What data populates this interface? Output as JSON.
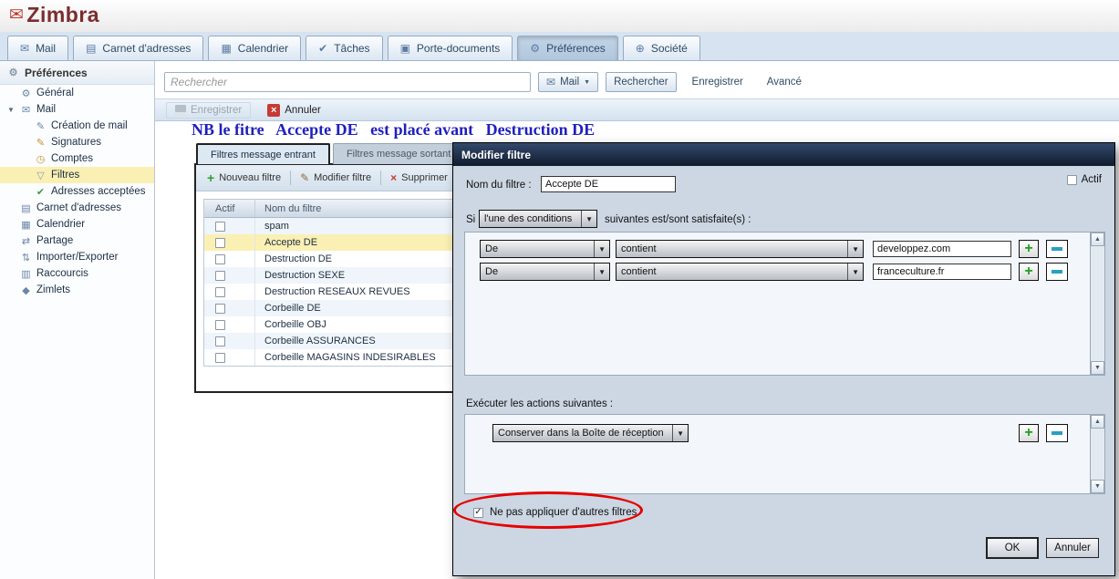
{
  "branding": {
    "logo_text": "Zimbra"
  },
  "colors": {
    "annotation_blue": "#1f1fbe",
    "annotation_red": "#e60000",
    "highlight_yellow": "#fbf0b4",
    "logo_red": "#7d2c2e",
    "modal_header": "#1b2a42"
  },
  "icons": {
    "logo_mark": "✉",
    "mail": "✉",
    "contacts": "▤",
    "calendar": "▦",
    "tasks": "✔",
    "briefcase": "▣",
    "gear": "⚙",
    "globe": "⊕",
    "compose": "✎",
    "signature": "✎",
    "accounts": "◷",
    "filter": "▽",
    "check_green": "✔",
    "share": "⇄",
    "import_export": "⇅",
    "shortcut": "▥",
    "zimlet": "◆",
    "expander_down": "▼",
    "dropdown_arrow": "▼",
    "scroll_up": "▲",
    "scroll_down": "▼",
    "plus": "+",
    "pencil": "✎",
    "close_x": "×",
    "checkmark": "✓"
  },
  "app_tabs": [
    {
      "label": "Mail"
    },
    {
      "label": "Carnet d'adresses"
    },
    {
      "label": "Calendrier"
    },
    {
      "label": "Tâches"
    },
    {
      "label": "Porte-documents"
    },
    {
      "label": "Préférences"
    },
    {
      "label": "Société"
    }
  ],
  "search_bar": {
    "placeholder": "Rechercher",
    "scope": "Mail",
    "search_button": "Rechercher",
    "save_button": "Enregistrer",
    "advanced_button": "Avancé"
  },
  "action_toolbar": {
    "save": "Enregistrer",
    "cancel": "Annuler"
  },
  "annotation_note": "NB le fitre   Accepte DE   est placé avant   Destruction DE",
  "sidebar": {
    "title": "Préférences",
    "items": [
      {
        "label": "Général"
      },
      {
        "label": "Mail"
      },
      {
        "label": "Création de mail"
      },
      {
        "label": "Signatures"
      },
      {
        "label": "Comptes"
      },
      {
        "label": "Filtres"
      },
      {
        "label": "Adresses acceptées"
      },
      {
        "label": "Carnet d'adresses"
      },
      {
        "label": "Calendrier"
      },
      {
        "label": "Partage"
      },
      {
        "label": "Importer/Exporter"
      },
      {
        "label": "Raccourcis"
      },
      {
        "label": "Zimlets"
      }
    ]
  },
  "filters_panel": {
    "tab_incoming": "Filtres message entrant",
    "tab_outgoing": "Filtres message sortant",
    "toolbar": {
      "new": "Nouveau filtre",
      "edit": "Modifier filtre",
      "delete": "Supprimer"
    },
    "columns": {
      "active": "Actif",
      "name": "Nom du filtre"
    },
    "rows": [
      {
        "name": "spam"
      },
      {
        "name": "Accepte DE"
      },
      {
        "name": "Destruction DE"
      },
      {
        "name": "Destruction SEXE"
      },
      {
        "name": "Destruction RESEAUX REVUES"
      },
      {
        "name": "Corbeille DE"
      },
      {
        "name": "Corbeille OBJ"
      },
      {
        "name": "Corbeille ASSURANCES"
      },
      {
        "name": "Corbeille MAGASINS INDESIRABLES"
      }
    ]
  },
  "dialog": {
    "title": "Modifier filtre",
    "name_label": "Nom du filtre :",
    "name_value": "Accepte DE",
    "active_label": "Actif",
    "if_prefix": "Si",
    "conditions_mode": "l'une des conditions",
    "if_suffix": "suivantes est/sont satisfaite(s) :",
    "conditions": [
      {
        "field": "De",
        "operator": "contient",
        "value": "developpez.com"
      },
      {
        "field": "De",
        "operator": "contient",
        "value": "franceculture.fr"
      }
    ],
    "actions_label": "Exécuter les actions suivantes :",
    "actions": [
      {
        "action": "Conserver dans la Boîte de réception"
      }
    ],
    "stop_label": "Ne pas appliquer d'autres filtres",
    "ok": "OK",
    "cancel": "Annuler"
  }
}
